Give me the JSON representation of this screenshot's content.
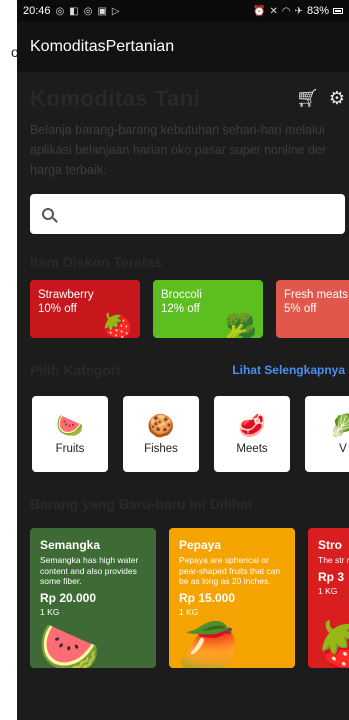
{
  "status_bar": {
    "time": "20:46",
    "battery": "83%",
    "left_icons": [
      "whatsapp-icon",
      "message-icon",
      "instagram-icon",
      "gallery-icon",
      "play-icon"
    ],
    "right_icons": [
      "alarm-icon",
      "mute-icon",
      "wifi-icon",
      "airplane-icon"
    ]
  },
  "appbar": {
    "title": "KomoditasPertanian"
  },
  "left_edge_text": "o.",
  "header": {
    "title": "Komoditas Tani",
    "description_lines": [
      "Belanja barang-barang kebutuhan sehari-hari melalui",
      "aplikasi belanjaan harian  oko pasar super nonline der",
      "harga terbaik."
    ]
  },
  "search": {
    "placeholder": ""
  },
  "discount_section": {
    "title": "Item Diskon Teratas",
    "items": [
      {
        "name": "Strawberry",
        "off": "10% off",
        "color": "#c8161d",
        "icon": "🍓"
      },
      {
        "name": "Broccoli",
        "off": "12% off",
        "color": "#5cbf1f",
        "icon": "🥦"
      },
      {
        "name": "Fresh meats",
        "off": "5% off",
        "color": "#e2574c",
        "icon": "🥩"
      }
    ]
  },
  "category_section": {
    "title": "Pilih Kategori",
    "see_more": "Lihat Selengkapnya",
    "items": [
      {
        "label": "Fruits",
        "icon": "🍉"
      },
      {
        "label": "Fishes",
        "icon": "🍪"
      },
      {
        "label": "Meets",
        "icon": "🥩"
      },
      {
        "label": "V",
        "icon": "🥬"
      }
    ]
  },
  "recent_section": {
    "title": "Barang yang Baru-baru ini Dilihat",
    "items": [
      {
        "name": "Semangka",
        "desc": "Semangka has high water content and also provides some fiber.",
        "price": "Rp 20.000",
        "unit": "1 KG",
        "color": "#3e6b35",
        "icon": "🍉"
      },
      {
        "name": "Pepaya",
        "desc": "Pepaya are spherical or pear-shaped fruits that can be as long as 20 inches.",
        "price": "Rp 15.000",
        "unit": "1 KG",
        "color": "#f5a300",
        "icon": "🥭"
      },
      {
        "name": "Stro",
        "desc": "The str nutritie with vi",
        "price": "Rp 3",
        "unit": "1 KG",
        "color": "#d81e1e",
        "icon": "🍓"
      }
    ]
  }
}
